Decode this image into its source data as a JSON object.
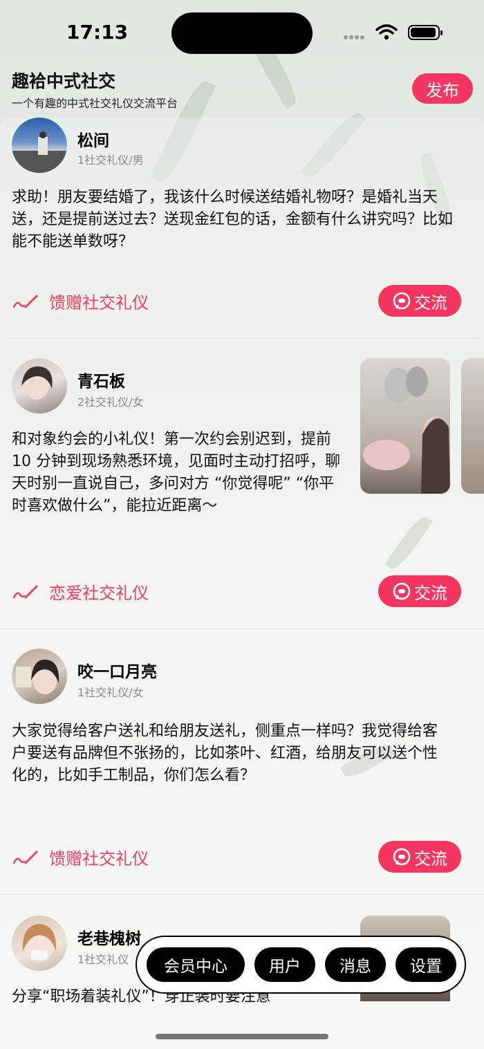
{
  "status": {
    "time": "17:13"
  },
  "header": {
    "title": "趣袷中式社交",
    "subtitle": "一个有趣的中式社交礼仪交流平台",
    "publish_label": "发布"
  },
  "posts": [
    {
      "name": "松间",
      "meta": "1社交礼仪/男",
      "content": "求助！朋友要结婚了，我该什么时候送结婚礼物呀？是婚礼当天送，还是提前送过去？送现金红包的话，金额有什么讲究吗？比如能不能送单数呀？",
      "category": "馈赠社交礼仪",
      "chat_label": "交流"
    },
    {
      "name": "青石板",
      "meta": "2社交礼仪/女",
      "content": "和对象约会的小礼仪！第一次约会别迟到，提前 10 分钟到现场熟悉环境，见面时主动打招呼，聊天时别一直说自己，多问对方 “你觉得呢” “你平时喜欢做什么”，能拉近距离～",
      "category": "恋爱社交礼仪",
      "chat_label": "交流"
    },
    {
      "name": "咬一口月亮",
      "meta": "1社交礼仪/女",
      "content": "大家觉得给客户送礼和给朋友送礼，侧重点一样吗？我觉得给客户要送有品牌但不张扬的，比如茶叶、红酒，给朋友可以送个性化的，比如手工制品，你们怎么看？",
      "category": "馈赠社交礼仪",
      "chat_label": "交流"
    },
    {
      "name": "老巷槐树",
      "meta": "1社交礼仪",
      "content": "分享“职场着装礼仪”！穿正装时要注意"
    }
  ],
  "tabbar": {
    "items": [
      {
        "label": "会员中心"
      },
      {
        "label": "用户"
      },
      {
        "label": "消息"
      },
      {
        "label": "设置"
      }
    ]
  },
  "colors": {
    "accent": "#f2365f",
    "category_text": "#ef3d64"
  },
  "icons": [
    "pen-icon",
    "chat-bubble-icon",
    "wifi-icon",
    "battery-icon"
  ]
}
